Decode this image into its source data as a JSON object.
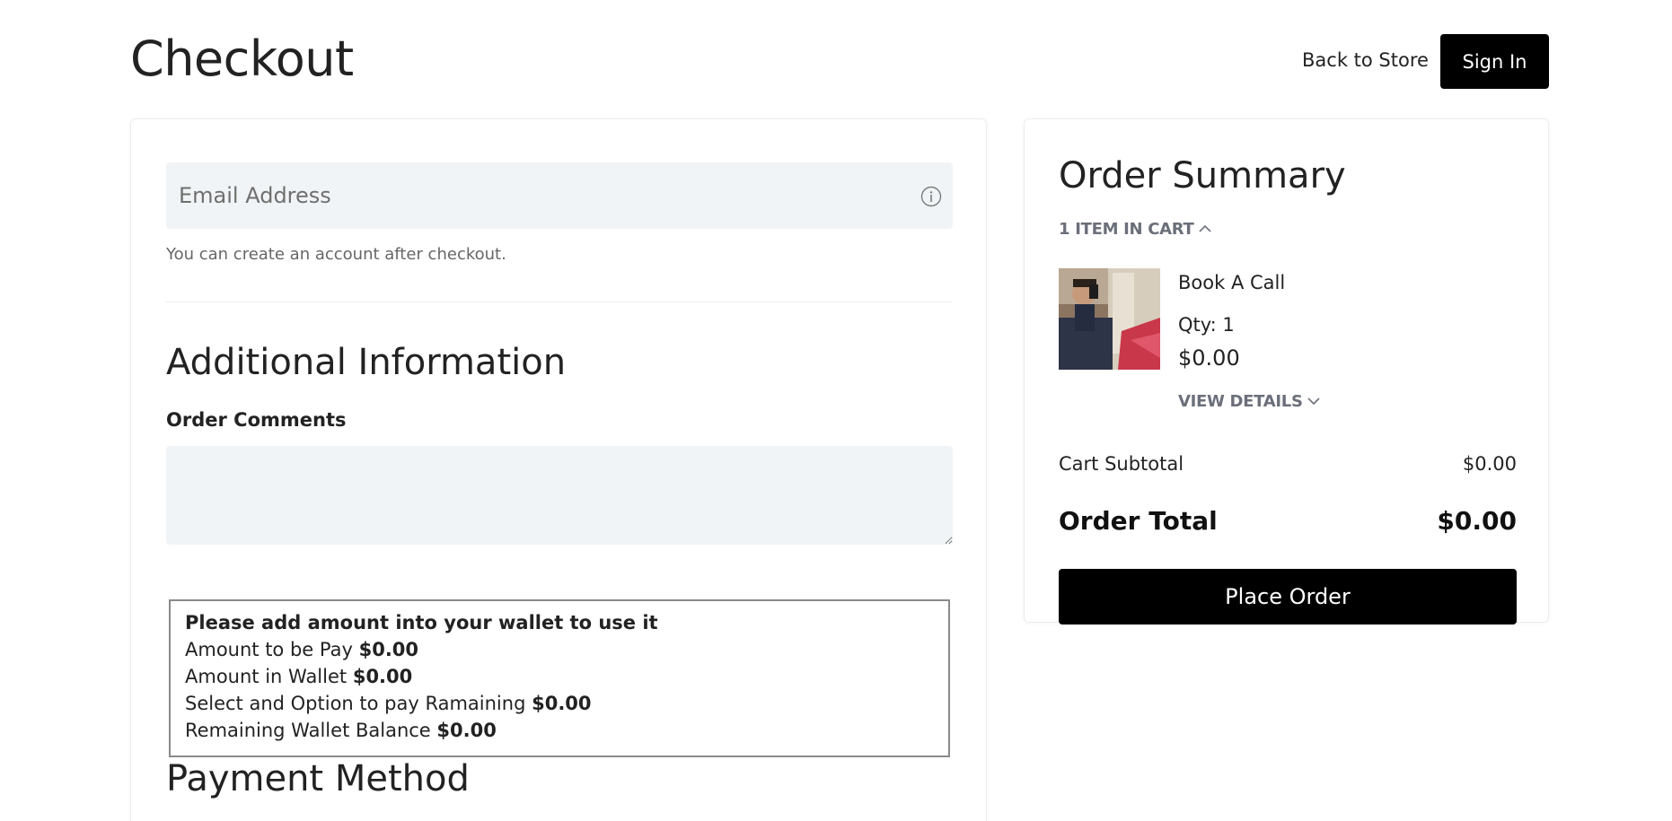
{
  "header": {
    "title": "Checkout",
    "back_link": "Back to Store",
    "sign_in": "Sign In"
  },
  "contact": {
    "email_placeholder": "Email Address",
    "email_hint": "You can create an account after checkout."
  },
  "additional": {
    "heading": "Additional Information",
    "comments_label": "Order Comments",
    "comments_value": ""
  },
  "wallet": {
    "title": "Please add amount into your wallet to use it",
    "amount_to_pay_label": "Amount to be Pay",
    "amount_to_pay": "$0.00",
    "amount_in_wallet_label": "Amount in Wallet",
    "amount_in_wallet": "$0.00",
    "remaining_label": "Select and Option to pay Ramaining",
    "remaining": "$0.00",
    "balance_label": "Remaining Wallet Balance",
    "balance": "$0.00"
  },
  "payment": {
    "heading": "Payment Method"
  },
  "summary": {
    "title": "Order Summary",
    "cart_count_label": "1 ITEM IN CART",
    "item": {
      "name": "Book A Call",
      "qty": "Qty: 1",
      "price": "$0.00",
      "view_details": "VIEW DETAILS"
    },
    "subtotal_label": "Cart Subtotal",
    "subtotal_value": "$0.00",
    "total_label": "Order Total",
    "total_value": "$0.00",
    "place_order": "Place Order"
  },
  "icons": {
    "email_info": "info-icon",
    "cart_toggle": "chevron-up-icon",
    "details_toggle": "chevron-down-icon"
  }
}
